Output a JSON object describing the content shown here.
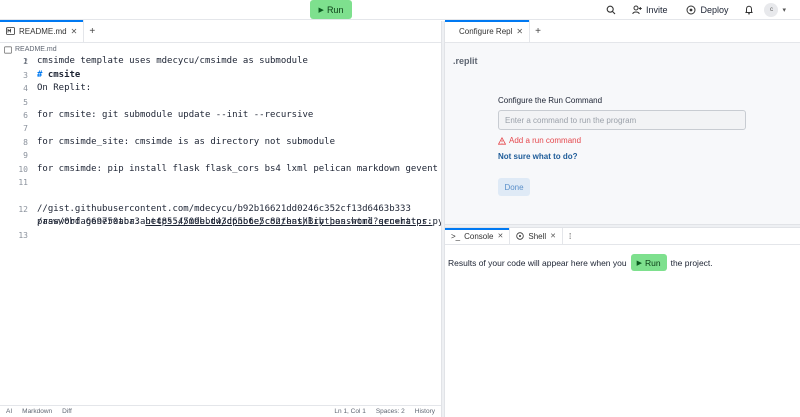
{
  "topbar": {
    "run_label": "Run",
    "invite_label": "Invite",
    "deploy_label": "Deploy",
    "avatar_initials": "c"
  },
  "editor": {
    "tab_label": "README.md",
    "breadcrumb": "README.md",
    "lines": [
      {
        "n": "1",
        "hash": "#",
        "text": "cmsite"
      },
      {
        "n": "2",
        "text": "cmsimde template uses mdecycu/cmsimde as submodule"
      },
      {
        "n": "3",
        "text": ""
      },
      {
        "n": "4",
        "text": "On Replit:"
      },
      {
        "n": "5",
        "text": ""
      },
      {
        "n": "6",
        "text": "for cmsite: git submodule update --init --recursive"
      },
      {
        "n": "7",
        "text": ""
      },
      {
        "n": "8",
        "text": "for cmsimde_site: cmsimde is as directory not submodule"
      },
      {
        "n": "9",
        "text": ""
      },
      {
        "n": "10",
        "text": "for cmsimde: pip install flask flask_cors bs4 lxml pelican markdown gevent"
      },
      {
        "n": "11",
        "text": ""
      },
      {
        "n": "12",
        "prefix": "password generator: ",
        "url1": "https://mde.tw/cpnote/content/Brython.html?src=https:"
      },
      {
        "n": "",
        "url2": "//gist.githubusercontent.com/mdecycu/b92b16621dd0246c352cf13d6463b333"
      },
      {
        "n": "",
        "url3": "/raw/0bfa669750aba3abe48554509bbd43d65b6e5c82/hashlib_password_generator.py"
      },
      {
        "n": "13",
        "text": ""
      }
    ],
    "status": {
      "ai": "AI",
      "language": "Markdown",
      "diff": "Diff",
      "position": "Ln 1, Col 1",
      "spaces": "Spaces: 2",
      "history": "History"
    }
  },
  "configure": {
    "tab_label": "Configure Repl",
    "title": ".replit",
    "label": "Configure the Run Command",
    "input_value": "",
    "input_placeholder": "Enter a command to run the program",
    "error": "Add a run command",
    "help_link": "Not sure what to do?",
    "done_label": "Done"
  },
  "console": {
    "tabs": [
      "Console",
      "Shell"
    ],
    "msg_before": "Results of your code will appear here when you",
    "run_label": "Run",
    "msg_after": "the project."
  }
}
